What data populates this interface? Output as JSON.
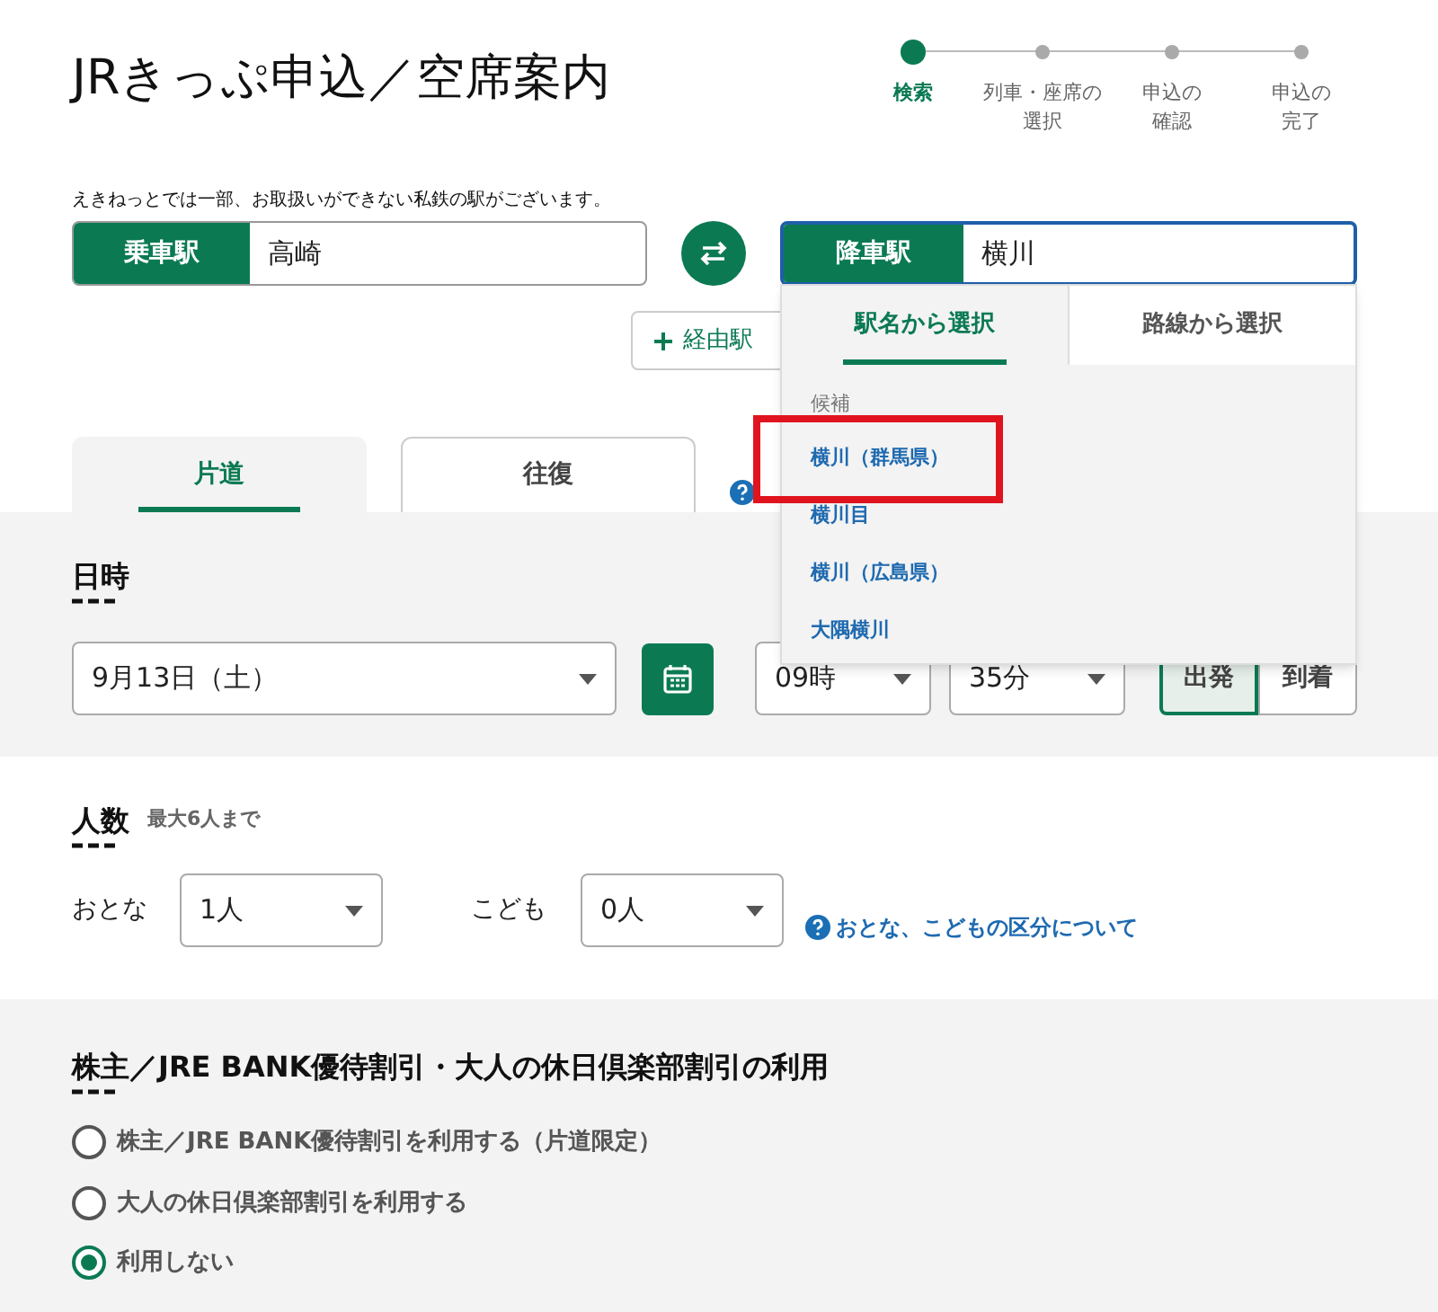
{
  "title": "JRきっぷ申込／空席案内",
  "steps": [
    {
      "label": "検索",
      "selected": true
    },
    {
      "label": "列車・座席の選択",
      "selected": false
    },
    {
      "label": "申込の確認",
      "selected": false
    },
    {
      "label": "申込の完了",
      "selected": false
    }
  ],
  "notice": "えきねっとでは一部、お取扱いができない私鉄の駅がございます。",
  "departure": {
    "label": "乗車駅",
    "value": "高崎"
  },
  "arrival": {
    "label": "降車駅",
    "value": "横川"
  },
  "via_button": "経由駅",
  "station_dropdown": {
    "tabs": [
      {
        "label": "駅名から選択",
        "selected": true
      },
      {
        "label": "路線から選択",
        "selected": false
      }
    ],
    "header": "候補",
    "items": [
      {
        "label": "横川（群馬県）",
        "highlighted": true
      },
      {
        "label": "横川目",
        "highlighted": false
      },
      {
        "label": "横川（広島県）",
        "highlighted": false
      },
      {
        "label": "大隅横川",
        "highlighted": false
      }
    ]
  },
  "trip_tabs": [
    {
      "label": "片道",
      "selected": true
    },
    {
      "label": "往復",
      "selected": false
    }
  ],
  "datetime": {
    "heading": "日時",
    "date": "9月13日（土）",
    "hour": "09時",
    "minute": "35分",
    "modes": [
      {
        "label": "出発",
        "selected": true
      },
      {
        "label": "到着",
        "selected": false
      }
    ]
  },
  "people": {
    "heading": "人数",
    "note": "最大6人まで",
    "adult_label": "おとな",
    "adult": "1人",
    "child_label": "こども",
    "child": "0人",
    "help_link": "おとな、こどもの区分について"
  },
  "discount": {
    "heading": "株主／JRE BANK優待割引・大人の休日倶楽部割引の利用",
    "options": [
      {
        "label": "株主／JRE BANK優待割引を利用する（片道限定）",
        "selected": false
      },
      {
        "label": "大人の休日倶楽部割引を利用する",
        "selected": false
      },
      {
        "label": "利用しない",
        "selected": true
      }
    ]
  }
}
